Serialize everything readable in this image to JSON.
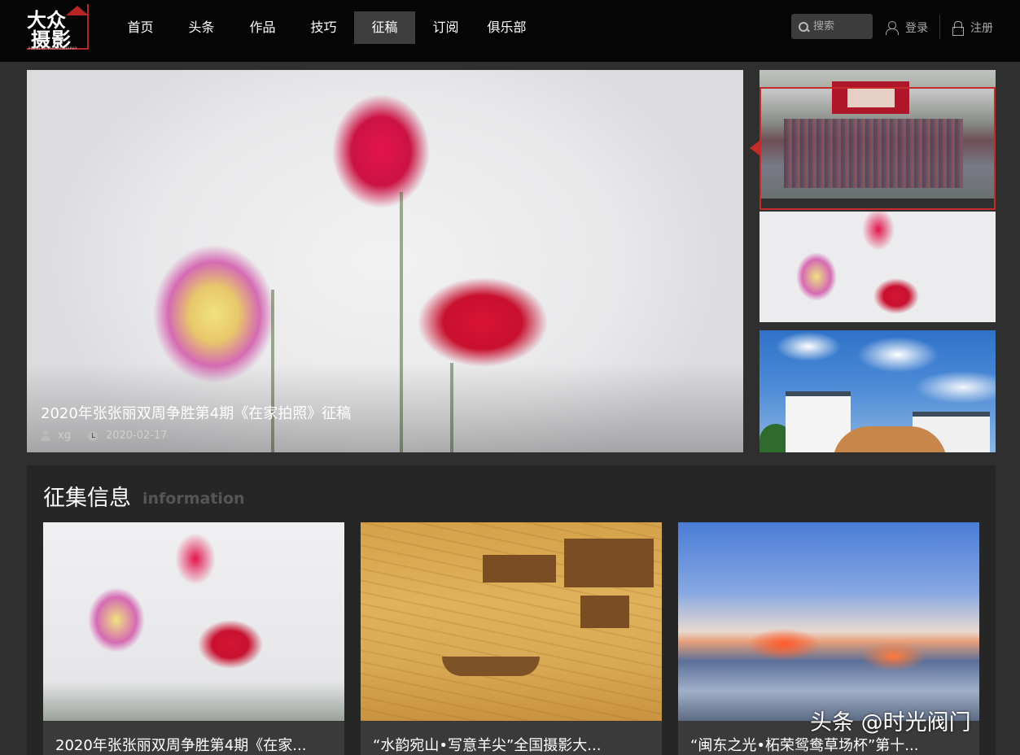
{
  "header": {
    "logo": {
      "line1": "大众",
      "line2": "摄影",
      "subtitle": "POPULAR PHOTOGRAPHY"
    },
    "nav": [
      {
        "label": "首页"
      },
      {
        "label": "头条"
      },
      {
        "label": "作品"
      },
      {
        "label": "技巧"
      },
      {
        "label": "征稿",
        "active": true
      },
      {
        "label": "订阅"
      },
      {
        "label": "俱乐部"
      }
    ],
    "search": {
      "placeholder": "搜索"
    },
    "login_label": "登录",
    "register_label": "注册"
  },
  "hero": {
    "title": "2020年张张丽双周争胜第4期《在家拍照》征稿",
    "author": "xg",
    "date": "2020-02-17"
  },
  "info": {
    "title": "征集信息",
    "subtitle": "information",
    "cards": [
      {
        "caption": "2020年张张丽双周争胜第4期《在家..."
      },
      {
        "caption": "“水韵宛山•写意羊尖”全国摄影大..."
      },
      {
        "caption": "“闽东之光•柘荣鸳鸯草场杯”第十..."
      }
    ]
  },
  "watermark": "头条 @时光阀门",
  "colors": {
    "accent": "#c42b2b",
    "header_bg": "#050505",
    "page_bg": "#2f2f2f",
    "section_bg": "#262626"
  }
}
